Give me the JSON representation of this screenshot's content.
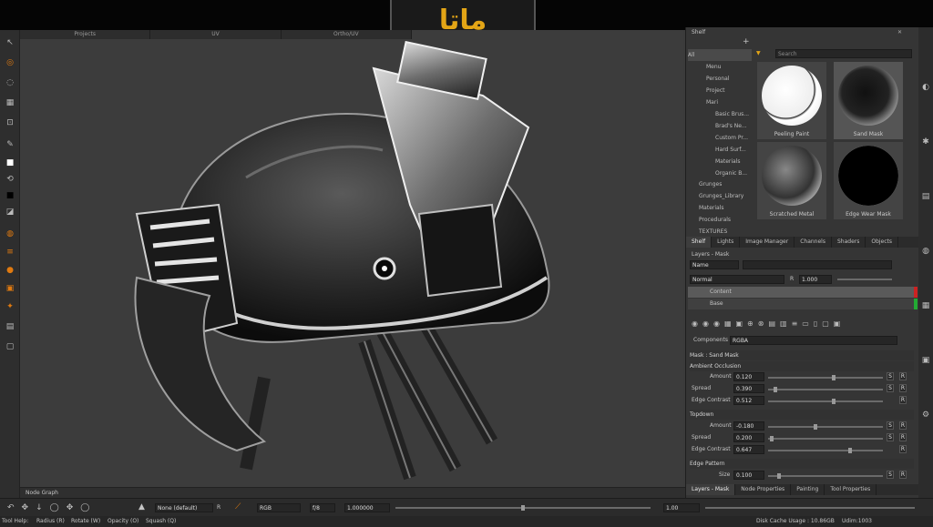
{
  "logo": {
    "text": "ماتا"
  },
  "colors": {
    "accent": "#e3a516",
    "red": "#cc2222",
    "green": "#22aa33",
    "orange": "#e07a10"
  },
  "viewport": {
    "tabs": [
      "Projects",
      "UV",
      "Ortho/UV"
    ]
  },
  "shelf": {
    "title": "Shelf",
    "search_placeholder": "Search",
    "tree": [
      "All",
      "Menu",
      "Personal",
      "Project",
      "Mari",
      "Basic Brus...",
      "Brad's Ne...",
      "Custom Pr...",
      "Hard Surf...",
      "Materials",
      "Organic B...",
      "Grunges",
      "Grunges_Library",
      "Materials",
      "Procedurals",
      "TEXTURES"
    ],
    "thumbnails": [
      "Peeling Paint",
      "Sand Mask",
      "Scratched Metal",
      "Edge Wear Mask"
    ]
  },
  "panel_tabs_top": [
    "Shelf",
    "Lights",
    "Image Manager",
    "Channels",
    "Shaders",
    "Objects"
  ],
  "layers": {
    "title": "Layers - Mask",
    "name_label": "Name",
    "blend_mode": "Normal",
    "opacity": "1.000",
    "items": [
      "Content",
      "Base"
    ]
  },
  "properties": {
    "components_label": "Components",
    "components_value": "RGBA",
    "mask_title": "Mask : Sand Mask",
    "sections": [
      {
        "name": "Ambient Occlusion",
        "rows": [
          {
            "label": "Amount",
            "value": "0.120"
          },
          {
            "label": "Spread",
            "value": "0.390"
          },
          {
            "label": "Edge Contrast",
            "value": "0.512"
          }
        ]
      },
      {
        "name": "Topdown",
        "rows": [
          {
            "label": "Amount",
            "value": "-0.180"
          },
          {
            "label": "Spread",
            "value": "0.200"
          },
          {
            "label": "Edge Contrast",
            "value": "0.647"
          }
        ]
      },
      {
        "name": "Edge Pattern",
        "rows": [
          {
            "label": "Size",
            "value": "0.100"
          }
        ]
      }
    ],
    "s_label": "S",
    "r_label": "R"
  },
  "panel_tabs_bottom": [
    "Layers - Mask",
    "Node Properties",
    "Painting",
    "Tool Properties"
  ],
  "node_graph": {
    "label": "Node Graph"
  },
  "bottom_toolbar": {
    "preset": "None (default)",
    "r_label": "R",
    "channel_mode": "RGB",
    "fstop": "f/8",
    "exposure": "1.000000",
    "gamma": "1.00"
  },
  "status": {
    "tool_help": "Tool Help:",
    "hints": [
      "Radius (R)",
      "Rotate (W)",
      "Opacity (O)",
      "Squash (Q)"
    ],
    "disk_cache": "Disk Cache Usage : 10.86GB",
    "udim": "Udim:1003"
  }
}
